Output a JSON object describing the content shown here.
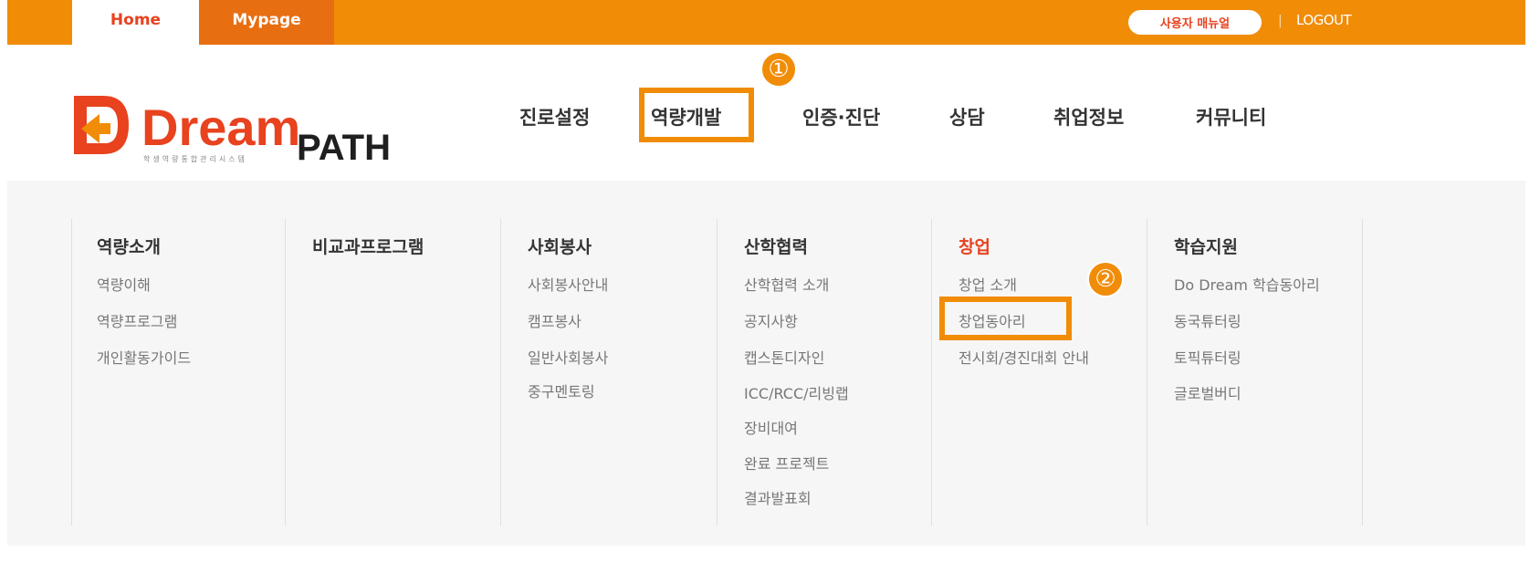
{
  "topbar": {
    "home": "Home",
    "mypage": "Mypage",
    "manual": "사용자 매뉴얼",
    "divider": "|",
    "logout": "LOGOUT"
  },
  "logo": {
    "word1": "Dream",
    "word2": "PATH",
    "tagline": "학생역량통합관리시스템"
  },
  "nav": [
    "진로설정",
    "역량개발",
    "인증·진단",
    "상담",
    "취업정보",
    "커뮤니티"
  ],
  "badges": [
    "①",
    "②"
  ],
  "menu": [
    {
      "title": "역량소개",
      "items": [
        "역량이해",
        "역량프로그램",
        "개인활동가이드"
      ]
    },
    {
      "title": "비교과프로그램",
      "items": []
    },
    {
      "title": "사회봉사",
      "items": [
        "사회봉사안내",
        "캠프봉사",
        "일반사회봉사",
        "중구멘토링"
      ]
    },
    {
      "title": "산학협력",
      "items": [
        "산학협력 소개",
        "공지사항",
        "캡스톤디자인",
        "ICC/RCC/리빙랩",
        "장비대여",
        "완료 프로젝트",
        "결과발표회"
      ]
    },
    {
      "title": "창업",
      "items": [
        "창업 소개",
        "창업동아리",
        "전시회/경진대회 안내"
      ]
    },
    {
      "title": "학습지원",
      "items": [
        "Do Dream 학습동아리",
        "동국튜터링",
        "토픽튜터링",
        "글로벌버디"
      ]
    }
  ],
  "colors": {
    "orange": "#f18c07",
    "red": "#e8421f"
  }
}
